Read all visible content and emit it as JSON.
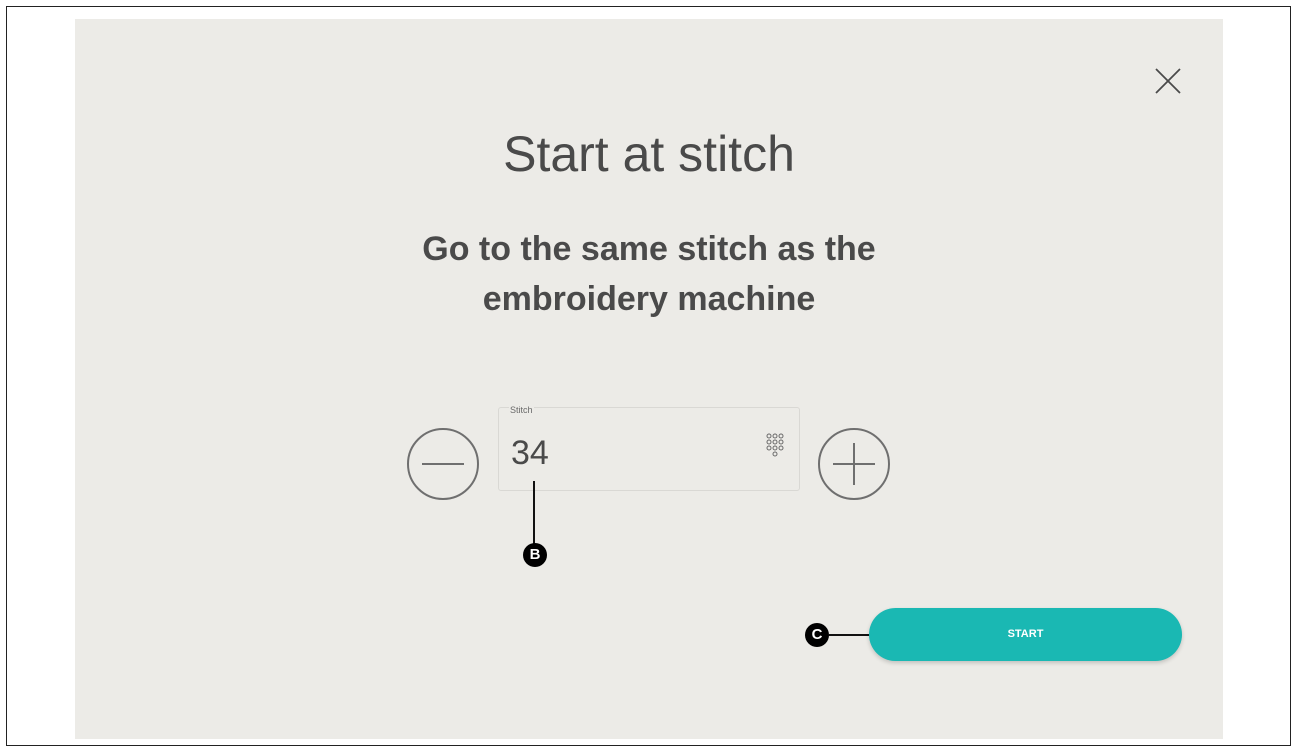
{
  "dialog": {
    "title": "Start at stitch",
    "subtitle_line1": "Go to the same stitch as the",
    "subtitle_line2": "embroidery machine",
    "close_icon": "close-icon"
  },
  "stitch_input": {
    "label": "Stitch",
    "value": "34",
    "keypad_icon": "keypad-icon"
  },
  "controls": {
    "minus_icon": "minus-icon",
    "plus_icon": "plus-icon",
    "start_label": "START"
  },
  "callouts": {
    "b": "B",
    "c": "C"
  },
  "colors": {
    "background": "#ecebe7",
    "accent": "#1ab8b3",
    "text": "#4a4a4a"
  }
}
